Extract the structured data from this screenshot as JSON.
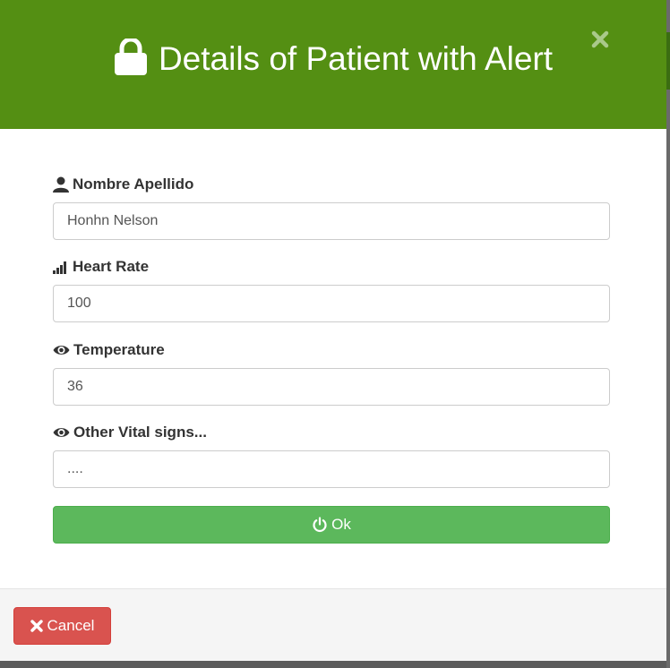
{
  "modal": {
    "title": "Details of Patient with Alert",
    "header_color": "#548f13",
    "title_icon": "lock-icon",
    "close_icon": "close-icon"
  },
  "fields": [
    {
      "label": "Nombre Apellido",
      "icon": "user-icon",
      "value": "Honhn Nelson"
    },
    {
      "label": "Heart Rate",
      "icon": "signal-icon",
      "value": "100"
    },
    {
      "label": "Temperature",
      "icon": "eye-icon",
      "value": "36"
    },
    {
      "label": "Other Vital signs...",
      "icon": "eye-icon",
      "value": "...."
    }
  ],
  "ok_button": {
    "label": "Ok",
    "icon": "power-icon",
    "color": "#5cb85c"
  },
  "cancel_button": {
    "label": "Cancel",
    "icon": "remove-icon",
    "color": "#d9534f"
  }
}
